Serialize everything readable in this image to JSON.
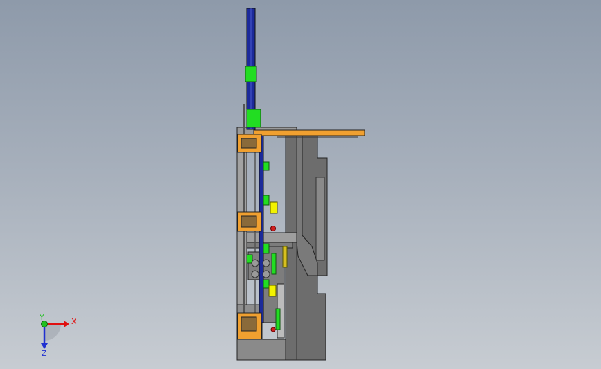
{
  "viewport": {
    "background_top": "#8e9aaa",
    "background_bottom": "#c7ccd2"
  },
  "triad": {
    "x_label": "X",
    "y_label": "Y",
    "z_label": "Z",
    "x_color": "#e01010",
    "y_color": "#20c020",
    "z_color": "#2030d0"
  },
  "model": {
    "colors": {
      "frame_gray": "#6d6d6d",
      "light_gray": "#9a9a9a",
      "rail_blue": "#1c2a9a",
      "green_part": "#22dd22",
      "orange_part": "#f0a030",
      "yellow_part": "#f2f200",
      "red_part": "#d02020",
      "edge": "#222222"
    }
  }
}
